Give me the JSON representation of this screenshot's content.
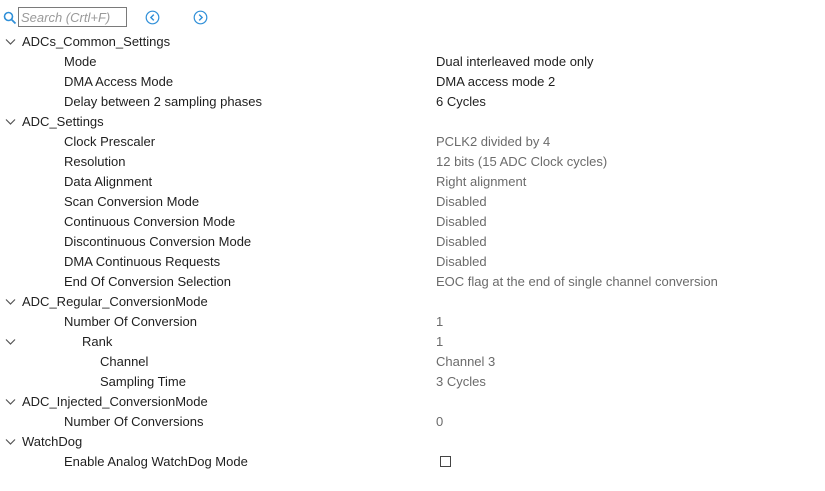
{
  "search": {
    "placeholder": "Search (Crtl+F)",
    "value": ""
  },
  "nav": {
    "prev_icon": "arrow-left-circle-icon",
    "next_icon": "arrow-right-circle-icon"
  },
  "colors": {
    "accent": "#2f8fd8",
    "dim_text": "#6b6b6b"
  },
  "tree": {
    "adcs_common": {
      "label": "ADCs_Common_Settings",
      "mode": {
        "label": "Mode",
        "value": "Dual interleaved mode only"
      },
      "dma_access_mode": {
        "label": "DMA Access Mode",
        "value": "DMA access mode 2"
      },
      "delay": {
        "label": "Delay between 2 sampling phases",
        "value": "6 Cycles"
      }
    },
    "adc_settings": {
      "label": "ADC_Settings",
      "clock_prescaler": {
        "label": "Clock Prescaler",
        "value": "PCLK2 divided by 4"
      },
      "resolution": {
        "label": "Resolution",
        "value": "12 bits (15 ADC Clock cycles)"
      },
      "data_alignment": {
        "label": "Data Alignment",
        "value": "Right alignment"
      },
      "scan_conversion": {
        "label": "Scan Conversion Mode",
        "value": "Disabled"
      },
      "continuous_conversion": {
        "label": "Continuous Conversion Mode",
        "value": "Disabled"
      },
      "discontinuous_conversion": {
        "label": "Discontinuous Conversion Mode",
        "value": "Disabled"
      },
      "dma_continuous": {
        "label": "DMA Continuous Requests",
        "value": "Disabled"
      },
      "eoc_selection": {
        "label": "End Of Conversion Selection",
        "value": "EOC flag at the end of single channel conversion"
      }
    },
    "regular_conversion": {
      "label": "ADC_Regular_ConversionMode",
      "number_of_conversion": {
        "label": "Number Of Conversion",
        "value": "1"
      },
      "rank": {
        "label": "Rank",
        "value": "1",
        "channel": {
          "label": "Channel",
          "value": "Channel 3"
        },
        "sampling_time": {
          "label": "Sampling Time",
          "value": "3 Cycles"
        }
      }
    },
    "injected_conversion": {
      "label": "ADC_Injected_ConversionMode",
      "number_of_conversions": {
        "label": "Number Of Conversions",
        "value": "0"
      }
    },
    "watchdog": {
      "label": "WatchDog",
      "enable_analog": {
        "label": "Enable Analog WatchDog Mode",
        "checked": false
      }
    }
  }
}
